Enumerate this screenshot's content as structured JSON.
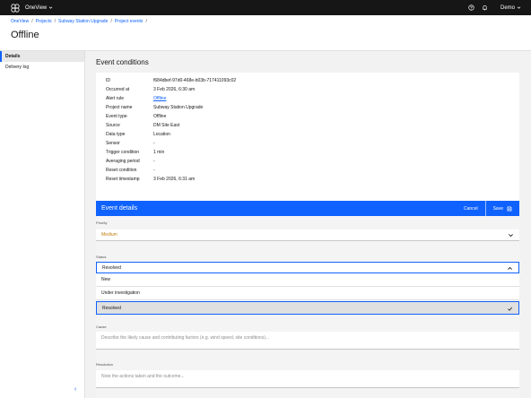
{
  "topbar": {
    "app_name": "OneView",
    "user": "Demo",
    "icons": [
      "app-logo-icon",
      "chevron-down-icon",
      "help-icon",
      "notification-icon"
    ]
  },
  "breadcrumb": [
    "OneView",
    "Projects",
    "Subway Station Upgrade",
    "Project events"
  ],
  "breadcrumb_separator": "/",
  "page_title": "Offline",
  "sidebar": {
    "items": [
      {
        "label": "Details",
        "active": true
      },
      {
        "label": "Delivery log",
        "active": false
      }
    ],
    "collapse_glyph": "‹"
  },
  "event_conditions": {
    "title": "Event conditions",
    "rows": [
      {
        "key": "ID",
        "value": "f684dbef-97d0-468e-b03b-717411093c02"
      },
      {
        "key": "Occurred at",
        "value": "3 Feb 2026, 6:30 am"
      },
      {
        "key": "Alert rule",
        "value": "Offline"
      },
      {
        "key": "Project name",
        "value": "Subway Station Upgrade"
      },
      {
        "key": "Event type",
        "value": "Offline"
      },
      {
        "key": "Source",
        "value": "DM Site East"
      },
      {
        "key": "Data type",
        "value": "Location"
      },
      {
        "key": "Sensor",
        "value": "-"
      },
      {
        "key": "Trigger condition",
        "value": "1 min"
      },
      {
        "key": "Averaging period",
        "value": "-"
      },
      {
        "key": "Reset condition",
        "value": "-"
      },
      {
        "key": "Reset timestamp",
        "value": "3 Feb 2026, 6:31 am"
      }
    ]
  },
  "event_details": {
    "title": "Event details",
    "cancel_label": "Cancel",
    "save_label": "Save",
    "priority": {
      "label": "Priority",
      "value": "Medium",
      "value_color": "#c27c0e"
    },
    "status": {
      "label": "Status",
      "value": "Resolved",
      "options": [
        "New",
        "Under investigation",
        "Resolved"
      ],
      "selected_index": 2
    },
    "cause": {
      "label": "Cause",
      "placeholder": "Describe the likely cause and contributing factors (e.g. wind speed, site conditions)..."
    },
    "resolution": {
      "label": "Resolution",
      "placeholder": "Note the actions taken and the outcome..."
    }
  },
  "colors": {
    "accent": "#0f62fe",
    "topbar": "#161616"
  }
}
